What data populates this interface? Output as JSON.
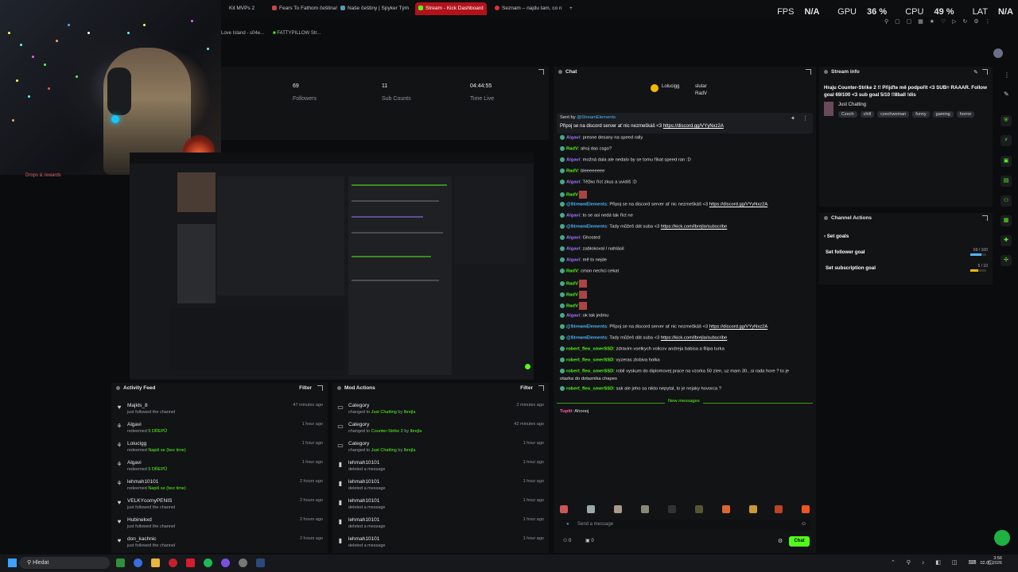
{
  "browser": {
    "tabs": [
      {
        "label": "Kit MVPs 2",
        "active": false
      },
      {
        "label": "Fears To Fathom čeština!",
        "active": false
      },
      {
        "label": "Naše češtiny | Spyker Tým",
        "active": false
      },
      {
        "label": "Stream - Kick Dashboard",
        "active": true
      },
      {
        "label": "Seznam – najdu tam, co n",
        "active": false
      }
    ],
    "new_tab": "+",
    "bookmarks": [
      "Love Island - s04e...",
      "FATTYPILLOW Str..."
    ]
  },
  "overlay": {
    "fps_label": "FPS",
    "fps_value": "N/A",
    "gpu_label": "GPU",
    "gpu_value": "36 %",
    "cpu_label": "CPU",
    "cpu_value": "49 %",
    "lat_label": "LAT",
    "lat_value": "N/A"
  },
  "stats": [
    {
      "value": "69",
      "label": "Followers"
    },
    {
      "value": "11",
      "label": "Sub Counts"
    },
    {
      "value": "04:44:55",
      "label": "Time Live"
    }
  ],
  "drops_label": "Drops & rewards",
  "chat": {
    "title": "Chat",
    "top_users": [
      "Lolucigg",
      "slutar",
      "RadV"
    ],
    "pinned_by": "Sent by",
    "pinned_user": "@StreamElements",
    "pinned_text": "Připoj se na discord server ať nic nezmeškáš <3",
    "pinned_link": "https://discord.gg/VYyNxz2A",
    "messages": [
      {
        "user": "Algavi",
        "cls": "purple",
        "text": "presne desany na speed rally",
        "link": ""
      },
      {
        "user": "RadV",
        "cls": "",
        "text": "ahoj das csgo?",
        "link": ""
      },
      {
        "user": "Algavi",
        "cls": "purple",
        "text": "možná dala ale nedalo by se tomu říkat speed ran :D",
        "link": ""
      },
      {
        "user": "RadV",
        "cls": "",
        "text": "bleeeeeeee",
        "link": ""
      },
      {
        "user": "Algavi",
        "cls": "purple",
        "text": "Těžko říct zkus a uvidíš :D",
        "link": ""
      },
      {
        "user": "RadV",
        "cls": "",
        "text": "",
        "link": ""
      },
      {
        "user": "@StreamElements",
        "cls": "blue",
        "text": "Připoj se na discord server ať nic nezmeškáš <3",
        "link": "https://discord.gg/VYyNxz2A"
      },
      {
        "user": "Algavi",
        "cls": "purple",
        "text": "to se asi nedá tak říct ne",
        "link": ""
      },
      {
        "user": "@StreamElements",
        "cls": "blue",
        "text": "Tady můžeš dát suba <3",
        "link": "https://kick.com/lbrejla/subscribe"
      },
      {
        "user": "Algavi",
        "cls": "purple",
        "text": "Ghosted",
        "link": ""
      },
      {
        "user": "Algavi",
        "cls": "purple",
        "text": "zablokoval / nahlásil",
        "link": ""
      },
      {
        "user": "Algavi",
        "cls": "purple",
        "text": "mě to nejde",
        "link": ""
      },
      {
        "user": "RadV",
        "cls": "",
        "text": "cmon nechci cekat",
        "link": ""
      },
      {
        "user": "RadV",
        "cls": "",
        "text": "",
        "link": ""
      },
      {
        "user": "RadV",
        "cls": "",
        "text": "",
        "link": ""
      },
      {
        "user": "RadV",
        "cls": "",
        "text": "",
        "link": ""
      },
      {
        "user": "Algavi",
        "cls": "purple",
        "text": "ok tak jedmu",
        "link": ""
      },
      {
        "user": "@StreamElements",
        "cls": "blue",
        "text": "Připoj se na discord server ať nic nezmeškáš <3",
        "link": "https://discord.gg/VYyNxz2A"
      },
      {
        "user": "@StreamElements",
        "cls": "blue",
        "text": "Tady můžeš dát suba <3",
        "link": "https://kick.com/lbrejla/subscribe"
      },
      {
        "user": "robert_fleo_smerSSD",
        "cls": "",
        "text": "zdravim vsetkych volicov andreja babisa a filipa turka",
        "link": ""
      },
      {
        "user": "robert_fleo_smerSSD",
        "cls": "",
        "text": "vyzeras zlobiva holka",
        "link": ""
      },
      {
        "user": "robert_fleo_smerSSD",
        "cls": "",
        "text": "robil vyskum do diplomovej prace na vzorka 50 zien, uz mam 30...si rada hore ? to je",
        "link": ""
      },
      {
        "user": "",
        "cls": "",
        "text": "otazka do dotaznika chapes",
        "link": ""
      },
      {
        "user": "robert_fleo_smerSSD",
        "cls": "",
        "text": "sak ale jeho sa nikto nepytal, to je nejaky hovorca ?",
        "link": ""
      }
    ],
    "new_messages": "New messages",
    "last_user": "Tupiti",
    "last_text": ": Ahoooj",
    "input_placeholder": "Send a message",
    "chat_button": "Chat",
    "counter_a": "0",
    "counter_b": "0"
  },
  "stream_info": {
    "title": "Stream info",
    "stream_title": "Hraju Counter-Strike 2 !! Přijďte mě podpořit <3 SUB= RAAAR. Follow goal 69/100 <3 sub goal 5/10 !!8ball !dis",
    "category": "Just Chatting",
    "tags": [
      "Czech",
      "chill",
      "czechwoman",
      "funny",
      "gaming",
      "horror"
    ]
  },
  "channel_actions": {
    "title": "Channel Actions",
    "back_label": "Set goals",
    "items": [
      {
        "label": "Set follower goal",
        "value": "69 / 100",
        "progress": 0.69
      },
      {
        "label": "Set subscription goal",
        "value": "5 / 10",
        "progress": 0.5
      }
    ]
  },
  "activity_feed": {
    "title": "Activity Feed",
    "filter": "Filter",
    "items": [
      {
        "name": "Majkls_8",
        "desc": "just followed the channel",
        "extra": "",
        "time": "47 minutes ago",
        "icon": "heart"
      },
      {
        "name": "Algavi",
        "desc": "redeemed",
        "extra": "5 DŘEPŮ",
        "time": "1 hour ago",
        "icon": "gift"
      },
      {
        "name": "Lolucigg",
        "desc": "redeemed",
        "extra": "Napiš se (bez time)",
        "time": "1 hour ago",
        "icon": "gift"
      },
      {
        "name": "Algavi",
        "desc": "redeemed",
        "extra": "5 DŘEPŮ",
        "time": "1 hour ago",
        "icon": "gift"
      },
      {
        "name": "lehmah10101",
        "desc": "redeemed",
        "extra": "Napiš se (bez time)",
        "time": "2 hours ago",
        "icon": "gift"
      },
      {
        "name": "VELKYcornyPENIS",
        "desc": "just followed the channel",
        "extra": "",
        "time": "2 hours ago",
        "icon": "heart"
      },
      {
        "name": "Hubinekxd",
        "desc": "just followed the channel",
        "extra": "",
        "time": "2 hours ago",
        "icon": "heart"
      },
      {
        "name": "don_kachnic",
        "desc": "just followed the channel",
        "extra": "",
        "time": "2 hours ago",
        "icon": "heart"
      }
    ]
  },
  "mod_actions": {
    "title": "Mod Actions",
    "filter": "Filter",
    "items": [
      {
        "name": "Category",
        "desc": "changed to",
        "extra": "Just Chatting",
        "by": "by",
        "byuser": "lbrejla",
        "time": "2 minutes ago",
        "icon": "window"
      },
      {
        "name": "Category",
        "desc": "changed to",
        "extra": "Counter-Strike 2",
        "by": "by",
        "byuser": "lbrejla",
        "time": "42 minutes ago",
        "icon": "window"
      },
      {
        "name": "Category",
        "desc": "changed to",
        "extra": "Just Chatting",
        "by": "by",
        "byuser": "lbrejla",
        "time": "1 hour ago",
        "icon": "window"
      },
      {
        "name": "lehmah10101",
        "desc": "deleted a message",
        "extra": "",
        "by": "",
        "byuser": "",
        "time": "1 hour ago",
        "icon": "trash"
      },
      {
        "name": "lehmah10101",
        "desc": "deleted a message",
        "extra": "",
        "by": "",
        "byuser": "",
        "time": "1 hour ago",
        "icon": "trash"
      },
      {
        "name": "lehmah10101",
        "desc": "deleted a message",
        "extra": "",
        "by": "",
        "byuser": "",
        "time": "1 hour ago",
        "icon": "trash"
      },
      {
        "name": "lehmah10101",
        "desc": "deleted a message",
        "extra": "",
        "by": "",
        "byuser": "",
        "time": "1 hour ago",
        "icon": "trash"
      },
      {
        "name": "lehmah10101",
        "desc": "deleted a message",
        "extra": "",
        "by": "",
        "byuser": "",
        "time": "1 hour ago",
        "icon": "trash"
      }
    ]
  },
  "taskbar": {
    "search_label": "Hledat",
    "time": "3:56",
    "date": "02.05.2026"
  },
  "colors": {
    "accent": "#53fc18",
    "panel": "#121315",
    "background": "#0b0c0d"
  }
}
